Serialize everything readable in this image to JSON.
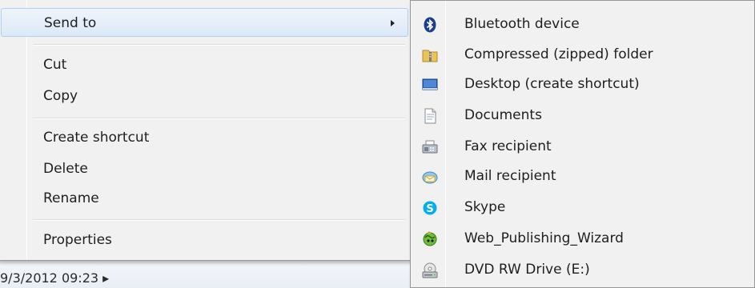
{
  "background": {
    "date_text": "9/3/2012 09:23 ▸"
  },
  "context_menu": {
    "items": [
      {
        "label": "Send to",
        "has_submenu": true,
        "highlighted": true
      },
      {
        "label": "Cut"
      },
      {
        "label": "Copy"
      },
      {
        "label": "Create shortcut"
      },
      {
        "label": "Delete"
      },
      {
        "label": "Rename"
      },
      {
        "label": "Properties"
      }
    ]
  },
  "send_to_submenu": {
    "items": [
      {
        "label": "Bluetooth device",
        "icon": "bluetooth-icon"
      },
      {
        "label": "Compressed (zipped) folder",
        "icon": "zip-folder-icon"
      },
      {
        "label": "Desktop (create shortcut)",
        "icon": "desktop-icon"
      },
      {
        "label": "Documents",
        "icon": "documents-icon"
      },
      {
        "label": "Fax recipient",
        "icon": "fax-icon"
      },
      {
        "label": "Mail recipient",
        "icon": "mail-icon"
      },
      {
        "label": "Skype",
        "icon": "skype-icon"
      },
      {
        "label": "Web_Publishing_Wizard",
        "icon": "web-publishing-wizard-icon"
      },
      {
        "label": "DVD RW Drive (E:)",
        "icon": "dvd-drive-icon"
      }
    ]
  },
  "colors": {
    "menu_background": "#f1f1f1",
    "highlight_border": "#aecff0",
    "bluetooth": "#1b3f8a",
    "skype": "#00aff0"
  }
}
